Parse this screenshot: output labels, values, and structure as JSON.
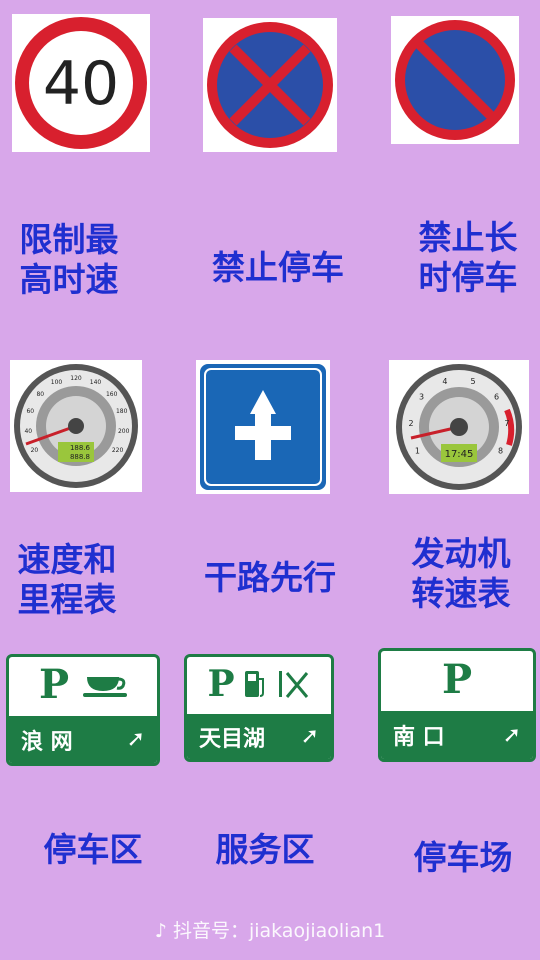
{
  "signs": [
    {
      "label": "限制最\n高时速",
      "value": "40"
    },
    {
      "label": "禁止停车"
    },
    {
      "label": "禁止长\n时停车"
    },
    {
      "label": "速度和\n里程表",
      "display_top": "188.6",
      "display_bottom": "888.8"
    },
    {
      "label": "干路先行"
    },
    {
      "label": "发动机\n转速表",
      "display": "17:45"
    },
    {
      "label": "停车区",
      "place": "浪  网"
    },
    {
      "label": "服务区",
      "place": "天目湖"
    },
    {
      "label": "停车场",
      "place": "南  口"
    }
  ],
  "parking_letter": "P",
  "speedo_scale": [
    "20",
    "40",
    "60",
    "80",
    "100",
    "120",
    "140",
    "160",
    "180",
    "200",
    "220"
  ],
  "tacho_scale": [
    "1",
    "2",
    "3",
    "4",
    "5",
    "6",
    "7",
    "8"
  ],
  "watermark": "抖音号：jiakaojiaolian1",
  "colors": {
    "background": "#d8a7ea",
    "label": "#1f2fd0",
    "sign_red": "#d8202e",
    "sign_blue": "#2b4fa8",
    "green": "#1e7c45",
    "guide_blue": "#1a67b6"
  }
}
